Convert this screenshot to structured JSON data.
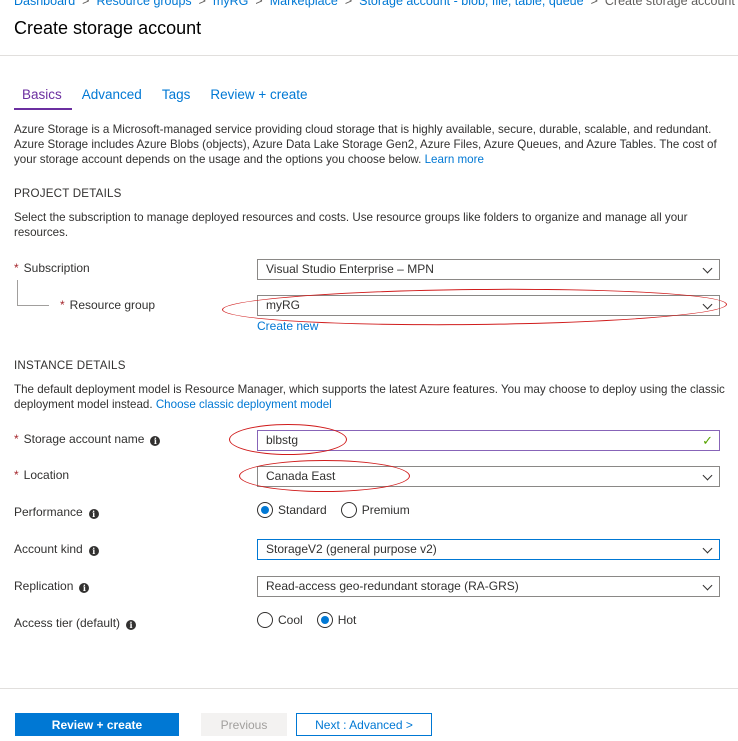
{
  "breadcrumb": {
    "items": [
      "Dashboard",
      "Resource groups",
      "myRG",
      "Marketplace",
      "Storage account - blob, file, table, queue"
    ],
    "current": "Create storage account",
    "separator": ">"
  },
  "page": {
    "title": "Create storage account"
  },
  "tabs": [
    {
      "label": "Basics",
      "active": true
    },
    {
      "label": "Advanced",
      "active": false
    },
    {
      "label": "Tags",
      "active": false
    },
    {
      "label": "Review + create",
      "active": false
    }
  ],
  "intro": {
    "text": "Azure Storage is a Microsoft-managed service providing cloud storage that is highly available, secure, durable, scalable, and redundant. Azure Storage includes Azure Blobs (objects), Azure Data Lake Storage Gen2, Azure Files, Azure Queues, and Azure Tables. The cost of your storage account depends on the usage and the options you choose below.",
    "learn_more": "Learn more"
  },
  "project": {
    "title": "PROJECT DETAILS",
    "description": "Select the subscription to manage deployed resources and costs. Use resource groups like folders to organize and manage all your resources.",
    "subscription_label": "Subscription",
    "subscription_value": "Visual Studio Enterprise – MPN",
    "resource_group_label": "Resource group",
    "resource_group_value": "myRG",
    "create_new": "Create new"
  },
  "instance": {
    "title": "INSTANCE DETAILS",
    "description": "The default deployment model is Resource Manager, which supports the latest Azure features. You may choose to deploy using the classic deployment model instead.",
    "classic_link": "Choose classic deployment model",
    "name_label": "Storage account name",
    "name_value": "blbstg",
    "location_label": "Location",
    "location_value": "Canada East",
    "performance_label": "Performance",
    "performance_options": [
      "Standard",
      "Premium"
    ],
    "performance_selected": "Standard",
    "account_kind_label": "Account kind",
    "account_kind_value": "StorageV2 (general purpose v2)",
    "replication_label": "Replication",
    "replication_value": "Read-access geo-redundant storage (RA-GRS)",
    "access_tier_label": "Access tier (default)",
    "access_tier_options": [
      "Cool",
      "Hot"
    ],
    "access_tier_selected": "Hot"
  },
  "icons": {
    "info": "i",
    "required": "*",
    "check": "✓"
  },
  "footer": {
    "review_create": "Review + create",
    "previous": "Previous",
    "next": "Next : Advanced >"
  },
  "colors": {
    "accent": "#0078d4",
    "tab_active": "#6b2fa0",
    "required": "#a4262c",
    "valid": "#57a300",
    "annotation": "#d01c1c"
  }
}
